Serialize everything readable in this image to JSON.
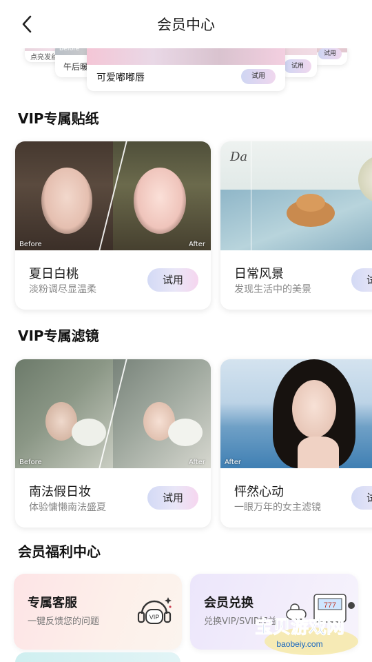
{
  "header": {
    "title": "会员中心"
  },
  "carousel": {
    "far_left_text": "点亮发丝",
    "left_text": "午后暖",
    "before_tag": "Before",
    "main_name": "可爱嘟嘟唇",
    "try_label": "试用"
  },
  "sticker_section": {
    "title": "VIP专属贴纸",
    "cards": [
      {
        "name": "夏日白桃",
        "desc": "淡粉调尽显温柔",
        "try": "试用",
        "before": "Before",
        "after": "After"
      },
      {
        "name": "日常风景",
        "desc": "发现生活中的美景",
        "try": "试"
      }
    ]
  },
  "filter_section": {
    "title": "VIP专属滤镜",
    "cards": [
      {
        "name": "南法假日妆",
        "desc": "体验慵懒南法盛夏",
        "try": "试用",
        "before": "Before",
        "after": "After"
      },
      {
        "name": "怦然心动",
        "desc": "一眼万年的女主滤镜",
        "try": "试",
        "after": "After"
      }
    ]
  },
  "welfare_section": {
    "title": "会员福利中心",
    "cards": [
      {
        "title": "专属客服",
        "desc": "一键反馈您的问题",
        "badge": "VIP"
      },
      {
        "title": "会员兑换",
        "desc": "兑换VIP/SVIP权益"
      }
    ]
  },
  "watermark": {
    "title": "宝贝游戏网",
    "url": "baobeiy.com"
  },
  "colors": {
    "try_pill_start": "#d3daf5",
    "try_pill_end": "#f6d6ef",
    "accent_text": "#1a1a1a",
    "watermark_blue": "#1565c0"
  }
}
